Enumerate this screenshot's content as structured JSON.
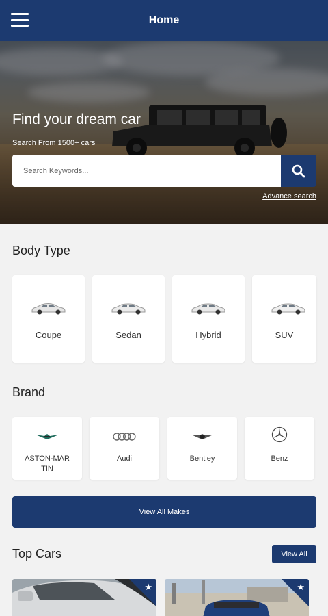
{
  "appbar": {
    "title": "Home",
    "menu_icon": "hamburger-menu-icon"
  },
  "hero": {
    "title": "Find your dream car",
    "subtitle": "Search From 1500+ cars",
    "search_placeholder": "Search Keywords...",
    "search_icon": "search-icon",
    "advanced_link": "Advance search"
  },
  "body_type": {
    "title": "Body Type",
    "items": [
      {
        "label": "Coupe",
        "icon": "car-icon"
      },
      {
        "label": "Sedan",
        "icon": "car-icon"
      },
      {
        "label": "Hybrid",
        "icon": "car-icon"
      },
      {
        "label": "SUV",
        "icon": "car-icon"
      }
    ]
  },
  "brand": {
    "title": "Brand",
    "items": [
      {
        "label": "ASTON-MARTIN",
        "icon": "aston-martin-logo-icon"
      },
      {
        "label": "Audi",
        "icon": "audi-logo-icon"
      },
      {
        "label": "Bentley",
        "icon": "bentley-logo-icon"
      },
      {
        "label": "Benz",
        "icon": "mercedes-benz-logo-icon"
      }
    ],
    "view_all_label": "View All Makes"
  },
  "top_cars": {
    "title": "Top Cars",
    "view_all_label": "View All",
    "badge_icon": "star-icon"
  },
  "colors": {
    "primary": "#1c3a70",
    "background": "#f2f2f2",
    "card": "#ffffff"
  }
}
